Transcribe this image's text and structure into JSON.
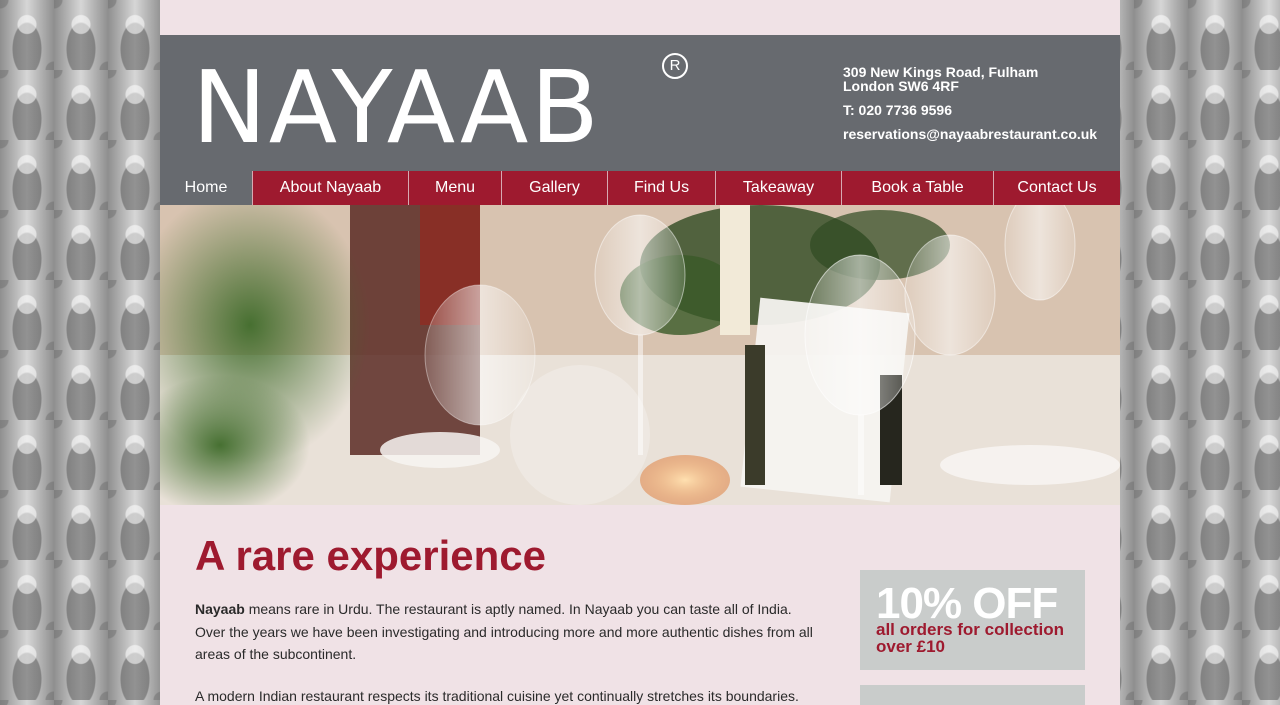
{
  "brand": {
    "logo": "NAYAAB",
    "registered_mark": "R"
  },
  "contact": {
    "address_line1": "309 New Kings Road, Fulham",
    "address_line2": "London SW6 4RF",
    "phone": "T: 020 7736 9596",
    "email": "reservations@nayaabrestaurant.co.uk"
  },
  "nav": {
    "items": [
      {
        "label": "Home",
        "active": true
      },
      {
        "label": "About Nayaab"
      },
      {
        "label": "Menu"
      },
      {
        "label": "Gallery"
      },
      {
        "label": "Find Us"
      },
      {
        "label": "Takeaway"
      },
      {
        "label": "Book a Table"
      },
      {
        "label": "Contact Us"
      }
    ]
  },
  "main": {
    "title": "A rare experience",
    "intro_bold": "Nayaab",
    "intro_rest": " means rare in Urdu. The restaurant is aptly named. In Nayaab you can taste all of India. Over the years we have been investigating and introducing more and more authentic dishes from all areas of the subcontinent.",
    "para2": "A modern Indian restaurant respects its traditional cuisine yet continually stretches its boundaries."
  },
  "promo": {
    "headline": "10% OFF",
    "line1": "all orders for collection",
    "line2": "over £10"
  },
  "colors": {
    "brand_red": "#9e1a2f",
    "header_grey": "#676a6f",
    "page_bg": "#f0e2e6",
    "promo_bg": "#c9cccb"
  }
}
